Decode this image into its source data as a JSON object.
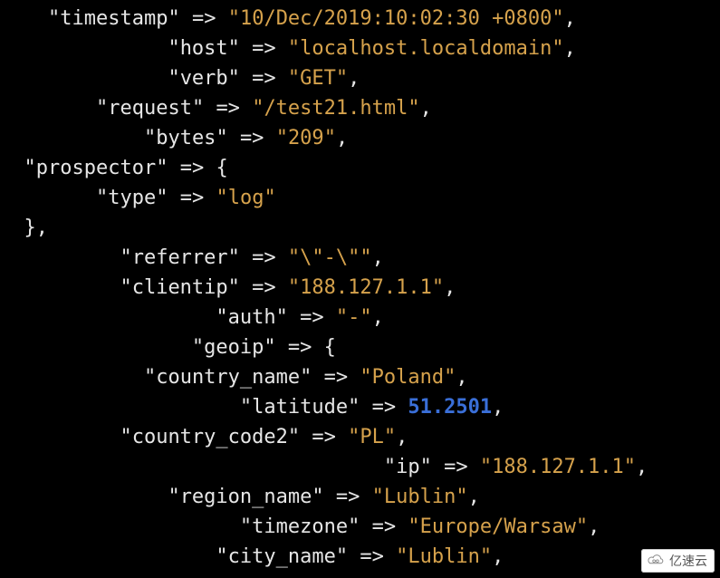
{
  "log_entry": {
    "fields": [
      {
        "key": "timestamp",
        "type": "string",
        "value": "10/Dec/2019:10:02:30 +0800",
        "indent_key": 4,
        "trailing_comma": true
      },
      {
        "key": "host",
        "type": "string",
        "value": "localhost.localdomain",
        "indent_key": 14,
        "trailing_comma": true
      },
      {
        "key": "verb",
        "type": "string",
        "value": "GET",
        "indent_key": 14,
        "trailing_comma": true
      },
      {
        "key": "request",
        "type": "string",
        "value": "/test21.html",
        "indent_key": 8,
        "trailing_comma": true
      },
      {
        "key": "bytes",
        "type": "string",
        "value": "209",
        "indent_key": 12,
        "trailing_comma": true
      },
      {
        "key": "prospector",
        "type": "open",
        "indent_key": 2
      },
      {
        "key": "type",
        "type": "string",
        "value": "log",
        "indent_key": 8,
        "trailing_comma": false
      },
      {
        "type": "close",
        "indent_close": 2,
        "trailing_comma": true
      },
      {
        "key": "referrer",
        "type": "string",
        "value": "\\\"-\\\"",
        "indent_key": 10,
        "trailing_comma": true
      },
      {
        "key": "clientip",
        "type": "string",
        "value": "188.127.1.1",
        "indent_key": 10,
        "trailing_comma": true
      },
      {
        "key": "auth",
        "type": "string",
        "value": "-",
        "indent_key": 18,
        "trailing_comma": true
      },
      {
        "key": "geoip",
        "type": "open",
        "indent_key": 16
      },
      {
        "key": "country_name",
        "type": "string",
        "value": "Poland",
        "indent_key": 12,
        "trailing_comma": true
      },
      {
        "key": "latitude",
        "type": "number",
        "value": "51.2501",
        "indent_key": 20,
        "trailing_comma": true
      },
      {
        "key": "country_code2",
        "type": "string",
        "value": "PL",
        "indent_key": 10,
        "trailing_comma": true
      },
      {
        "key": "ip",
        "type": "string",
        "value": "188.127.1.1",
        "indent_key": 32,
        "trailing_comma": true
      },
      {
        "key": "region_name",
        "type": "string",
        "value": "Lublin",
        "indent_key": 14,
        "trailing_comma": true
      },
      {
        "key": "timezone",
        "type": "string",
        "value": "Europe/Warsaw",
        "indent_key": 20,
        "trailing_comma": true
      },
      {
        "key": "city_name",
        "type": "string",
        "value": "Lublin",
        "indent_key": 18,
        "trailing_comma": true
      }
    ]
  },
  "watermark": {
    "text": "亿速云"
  }
}
